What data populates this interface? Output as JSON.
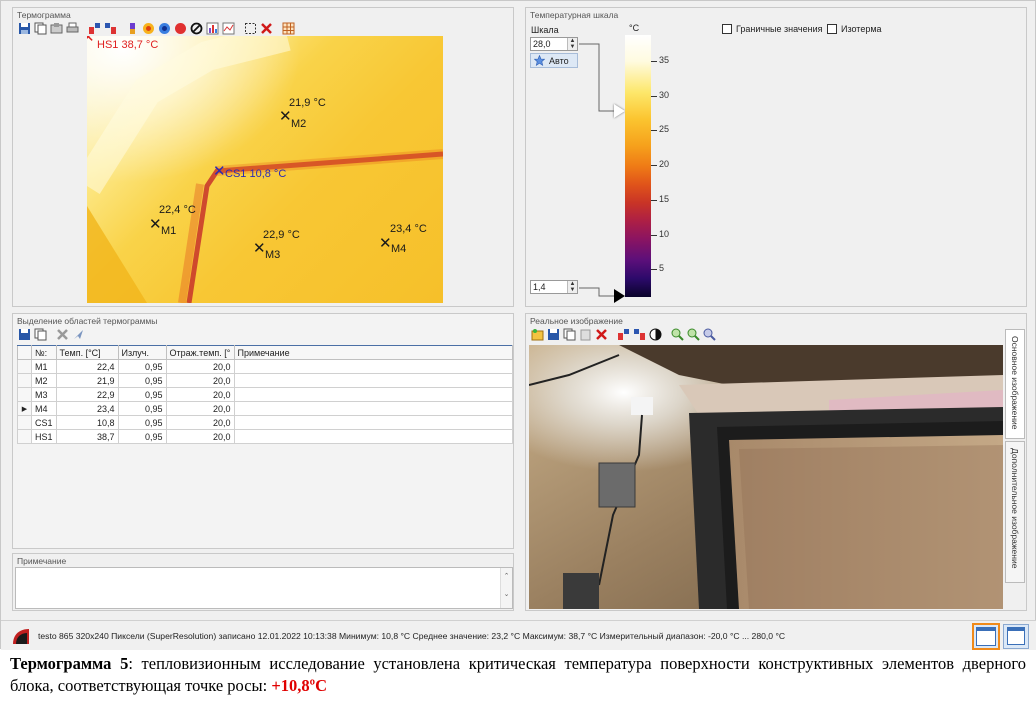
{
  "panels": {
    "thermogram_title": "Термограмма",
    "scale_title": "Температурная шкала",
    "areas_title": "Выделение областей термограммы",
    "note_title": "Примечание",
    "real_title": "Реальное изображение"
  },
  "thermogram": {
    "markers": [
      {
        "id": "HS1",
        "label": "HS1 38,7 °C",
        "color": "#e02020"
      },
      {
        "id": "M2",
        "value": "21,9 °C"
      },
      {
        "id": "CS1",
        "label": "CS1 10,8 °C",
        "color": "#2b2bb5"
      },
      {
        "id": "M1",
        "value": "22,4 °C"
      },
      {
        "id": "M3",
        "value": "22,9 °C"
      },
      {
        "id": "M4",
        "value": "23,4 °C"
      }
    ]
  },
  "scale": {
    "label": "Шкала",
    "unit": "°C",
    "max_value": "28,0",
    "min_value": "1,4",
    "auto_button": "Авто",
    "limit_values_label": "Граничные значения",
    "isotherm_label": "Изотерма",
    "ticks": [
      "35",
      "30",
      "25",
      "20",
      "15",
      "10",
      "5"
    ]
  },
  "table": {
    "headers": [
      "№:",
      "Темп. [°C]",
      "Излуч.",
      "Отраж.темп. [°",
      "Примечание"
    ],
    "rows": [
      [
        "M1",
        "22,4",
        "0,95",
        "20,0",
        ""
      ],
      [
        "M2",
        "21,9",
        "0,95",
        "20,0",
        ""
      ],
      [
        "M3",
        "22,9",
        "0,95",
        "20,0",
        ""
      ],
      [
        "M4",
        "23,4",
        "0,95",
        "20,0",
        ""
      ],
      [
        "CS1",
        "10,8",
        "0,95",
        "20,0",
        ""
      ],
      [
        "HS1",
        "38,7",
        "0,95",
        "20,0",
        ""
      ]
    ],
    "selected_row_marker": "▶"
  },
  "real_image": {
    "tabs": [
      "Основное изображение",
      "Дополнительное изображение"
    ]
  },
  "status": {
    "text": "testo 865 320x240 Пиксели (SuperResolution) записано 12.01.2022 10:13:38 Минимум: 10,8 °C Среднее значение: 23,2 °C Максимум: 38,7 °C Измерительный диапазон: -20,0 °C ... 280,0 °C"
  },
  "caption": {
    "bold": "Термограмма  5",
    "text": ": тепловизионным исследование установлена критическая температура поверхности конструктивных элементов дверного блока, соответствующая точке росы: ",
    "value": "+10,8ºC"
  }
}
